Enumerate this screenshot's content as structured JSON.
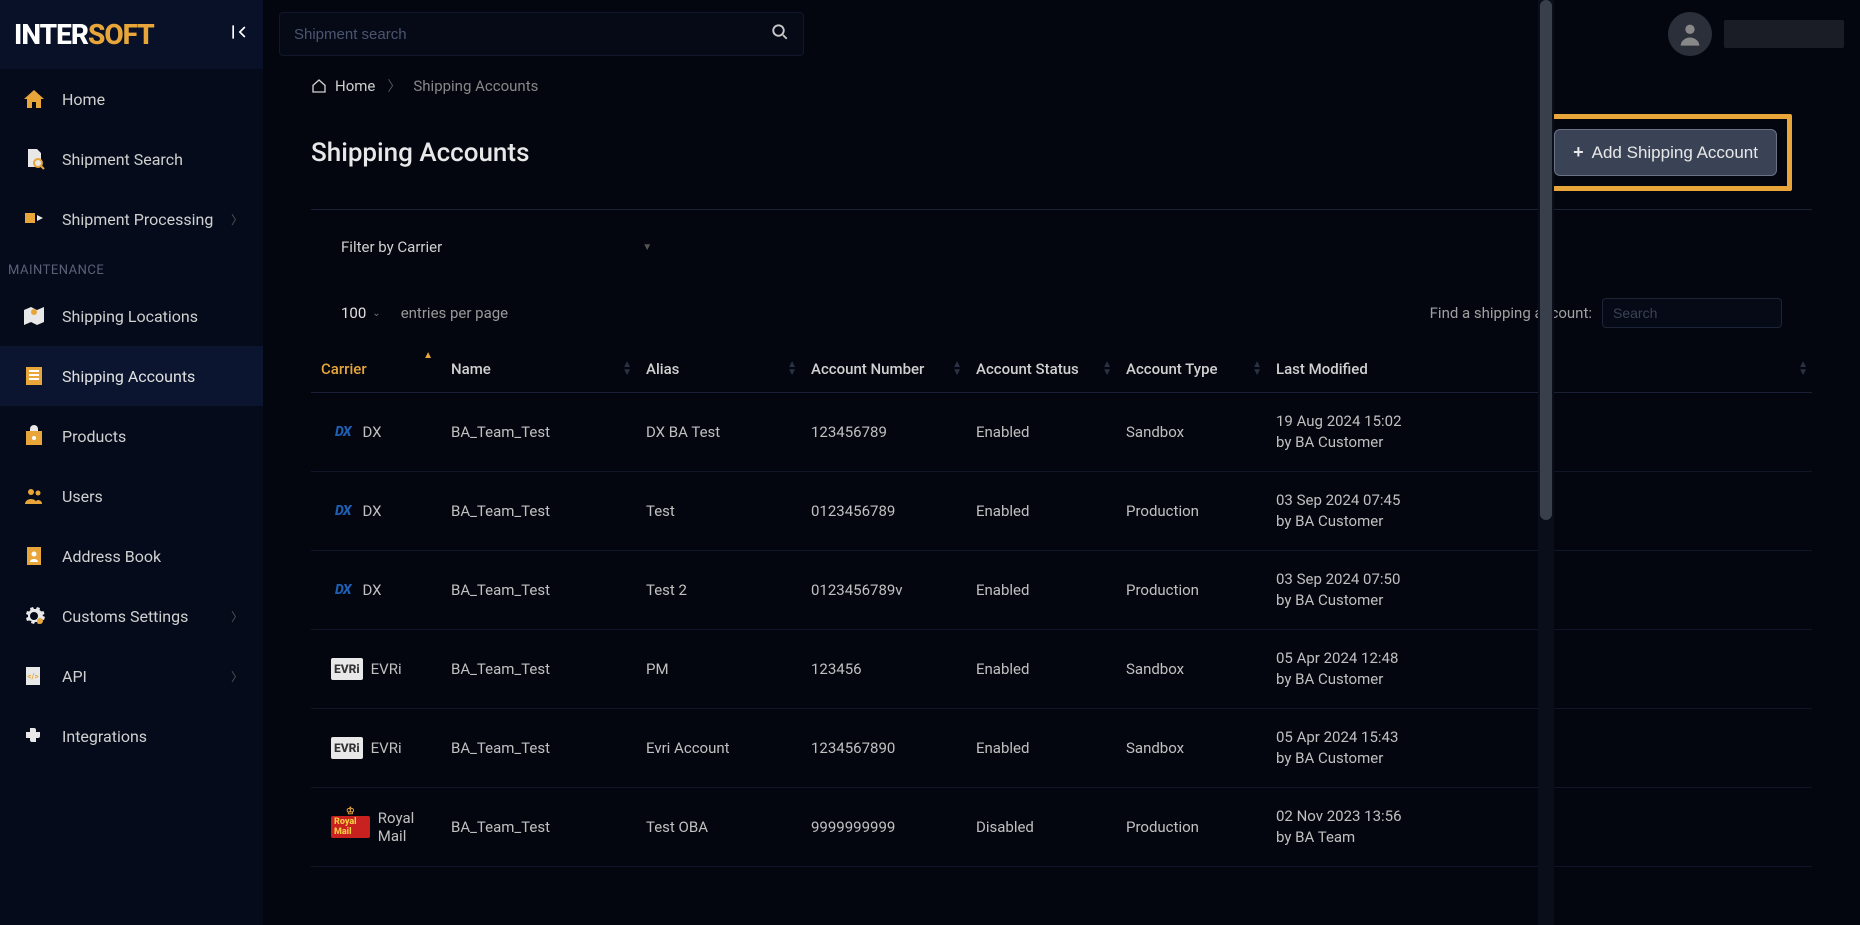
{
  "brand": {
    "part1": "INTER",
    "part2": "SOFT"
  },
  "search": {
    "placeholder": "Shipment search"
  },
  "sidebar": {
    "items": [
      {
        "label": "Home",
        "icon": "home"
      },
      {
        "label": "Shipment Search",
        "icon": "search-doc"
      },
      {
        "label": "Shipment Processing",
        "icon": "processing",
        "expandable": true
      }
    ],
    "section_label": "MAINTENANCE",
    "maint": [
      {
        "label": "Shipping Locations",
        "icon": "map-pin"
      },
      {
        "label": "Shipping Accounts",
        "icon": "accounts",
        "active": true
      },
      {
        "label": "Products",
        "icon": "products"
      },
      {
        "label": "Users",
        "icon": "users"
      },
      {
        "label": "Address Book",
        "icon": "address"
      },
      {
        "label": "Customs Settings",
        "icon": "gear",
        "expandable": true
      },
      {
        "label": "API",
        "icon": "api",
        "expandable": true
      },
      {
        "label": "Integrations",
        "icon": "puzzle"
      }
    ]
  },
  "breadcrumb": {
    "home": "Home",
    "current": "Shipping Accounts"
  },
  "page": {
    "title": "Shipping Accounts"
  },
  "add_button": "Add Shipping Account",
  "filter": {
    "label": "Filter by Carrier"
  },
  "entries": {
    "value": "100",
    "label": "entries per page"
  },
  "find": {
    "label": "Find a shipping account:",
    "placeholder": "Search"
  },
  "columns": {
    "carrier": "Carrier",
    "name": "Name",
    "alias": "Alias",
    "account_number": "Account Number",
    "account_status": "Account Status",
    "account_type": "Account Type",
    "last_modified": "Last Modified"
  },
  "rows": [
    {
      "carrier": "DX",
      "carrier_logo": "dx",
      "name": "BA_Team_Test",
      "alias": "DX BA Test",
      "number": "123456789",
      "status": "Enabled",
      "type": "Sandbox",
      "modified_date": "19 Aug 2024 15:02",
      "modified_by": "by BA Customer"
    },
    {
      "carrier": "DX",
      "carrier_logo": "dx",
      "name": "BA_Team_Test",
      "alias": "Test",
      "number": "0123456789",
      "status": "Enabled",
      "type": "Production",
      "modified_date": "03 Sep 2024 07:45",
      "modified_by": "by BA Customer"
    },
    {
      "carrier": "DX",
      "carrier_logo": "dx",
      "name": "BA_Team_Test",
      "alias": "Test 2",
      "number": "0123456789v",
      "status": "Enabled",
      "type": "Production",
      "modified_date": "03 Sep 2024 07:50",
      "modified_by": "by BA Customer"
    },
    {
      "carrier": "EVRi",
      "carrier_logo": "evri",
      "name": "BA_Team_Test",
      "alias": "PM",
      "number": "123456",
      "status": "Enabled",
      "type": "Sandbox",
      "modified_date": "05 Apr 2024 12:48",
      "modified_by": "by BA Customer"
    },
    {
      "carrier": "EVRi",
      "carrier_logo": "evri",
      "name": "BA_Team_Test",
      "alias": "Evri Account",
      "number": "1234567890",
      "status": "Enabled",
      "type": "Sandbox",
      "modified_date": "05 Apr 2024 15:43",
      "modified_by": "by BA Customer"
    },
    {
      "carrier": "Royal Mail",
      "carrier_logo": "rm",
      "name": "BA_Team_Test",
      "alias": "Test OBA",
      "number": "9999999999",
      "status": "Disabled",
      "type": "Production",
      "modified_date": "02 Nov 2023 13:56",
      "modified_by": "by BA Team"
    }
  ]
}
